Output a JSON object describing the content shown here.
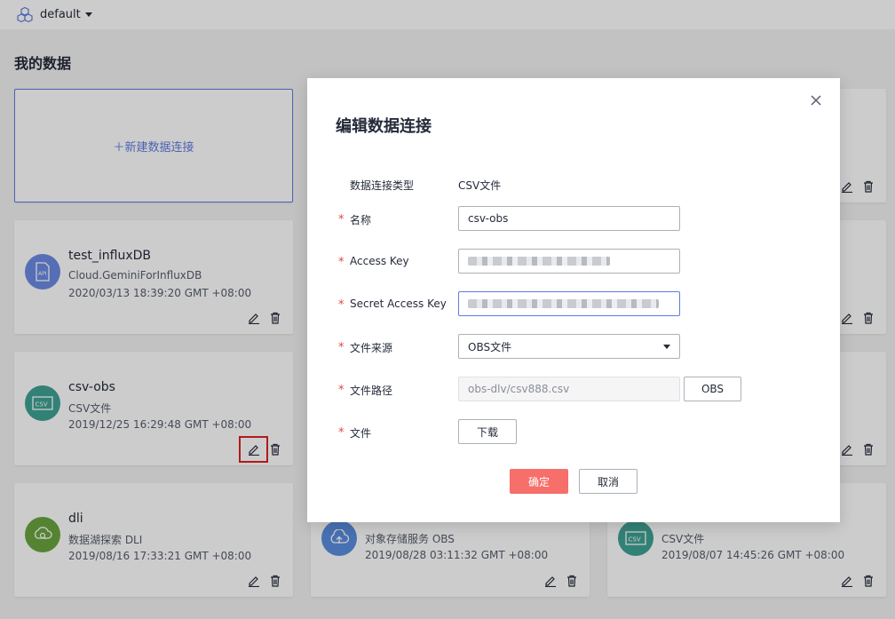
{
  "topbar": {
    "project": "default"
  },
  "page": {
    "title": "我的数据",
    "new_connection": "＋新建数据连接"
  },
  "cards": [
    {
      "name": "test_influxDB",
      "sub": "Cloud.GeminiForInfluxDB",
      "time": "2020/03/13 18:39:20 GMT +08:00",
      "color": "#6c8ae4",
      "icon": "api-icon"
    },
    {
      "name": "csv-obs",
      "sub": "CSV文件",
      "time": "2019/12/25 16:29:48 GMT +08:00",
      "color": "#3fa294",
      "icon": "csv-icon"
    },
    {
      "name": "dli",
      "sub": "数据湖探索 DLI",
      "time": "2019/08/16 17:33:21 GMT +08:00",
      "color": "#6aa63f",
      "icon": "dli-icon"
    },
    {
      "name": "",
      "sub": "对象存储服务 OBS",
      "time": "2019/08/28 03:11:32 GMT +08:00",
      "color": "#5b8ee0",
      "icon": "cloud-upload-icon"
    },
    {
      "name": "",
      "sub": "CSV文件",
      "time": "2019/08/07 14:45:26 GMT +08:00",
      "color": "#3fa294",
      "icon": "csv-icon"
    }
  ],
  "modal": {
    "title": "编辑数据连接",
    "type_label": "数据连接类型",
    "type_value": "CSV文件",
    "name_label": "名称",
    "name_value": "csv-obs",
    "ak_label": "Access Key",
    "sk_label": "Secret Access Key",
    "source_label": "文件来源",
    "source_value": "OBS文件",
    "path_label": "文件路径",
    "path_value": "obs-dlv/csv888.csv",
    "obs_button": "OBS",
    "file_label": "文件",
    "download_button": "下载",
    "ok_button": "确定",
    "cancel_button": "取消"
  }
}
